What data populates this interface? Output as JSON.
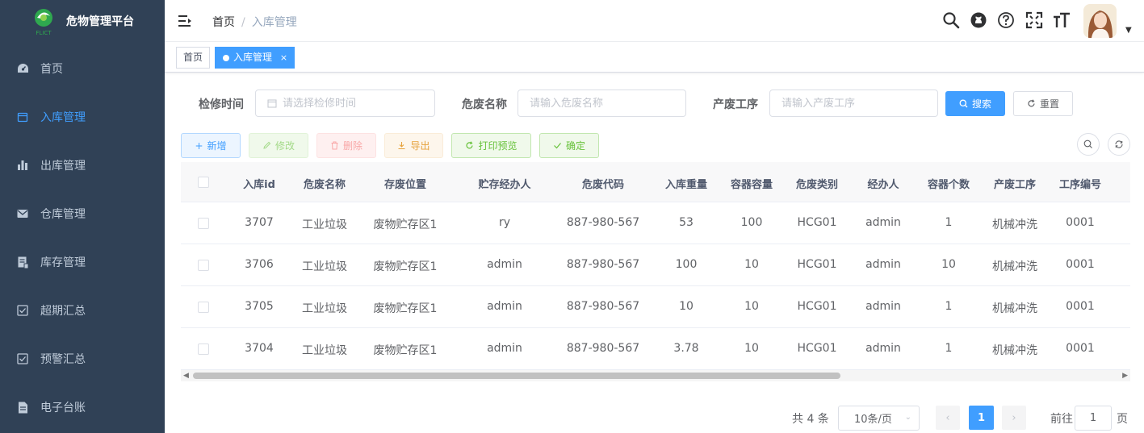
{
  "app": {
    "title": "危物管理平台",
    "logo_sub": "FLICT"
  },
  "sidebar": {
    "items": [
      {
        "label": "首页",
        "icon": "dashboard-icon",
        "active": false
      },
      {
        "label": "入库管理",
        "icon": "calendar-icon",
        "active": true
      },
      {
        "label": "出库管理",
        "icon": "bar-chart-icon",
        "active": false
      },
      {
        "label": "仓库管理",
        "icon": "mail-icon",
        "active": false
      },
      {
        "label": "库存管理",
        "icon": "document-icon",
        "active": false
      },
      {
        "label": "超期汇总",
        "icon": "checkbox-icon",
        "active": false
      },
      {
        "label": "预警汇总",
        "icon": "checkbox-icon",
        "active": false
      },
      {
        "label": "电子台账",
        "icon": "file-icon",
        "active": false
      }
    ]
  },
  "navbar": {
    "breadcrumb": {
      "home": "首页",
      "separator": "/",
      "current": "入库管理"
    }
  },
  "tags": {
    "home": "首页",
    "active": "入库管理",
    "close": "×"
  },
  "search": {
    "fields": [
      {
        "label": "检修时间",
        "placeholder": "请选择检修时间"
      },
      {
        "label": "危废名称",
        "placeholder": "请输入危废名称"
      },
      {
        "label": "产废工序",
        "placeholder": "请输入产废工序"
      }
    ],
    "search_label": "搜索",
    "reset_label": "重置"
  },
  "toolbar": {
    "add": "新增",
    "edit": "修改",
    "delete": "删除",
    "export": "导出",
    "print": "打印预览",
    "confirm": "确定"
  },
  "table": {
    "headers": [
      "入库id",
      "危废名称",
      "存废位置",
      "贮存经办人",
      "危废代码",
      "入库重量",
      "容器容量",
      "危废类别",
      "经办人",
      "容器个数",
      "产废工序",
      "工序编号"
    ],
    "rows": [
      [
        "3707",
        "工业垃圾",
        "废物贮存区1",
        "ry",
        "887-980-567",
        "53",
        "100",
        "HCG01",
        "admin",
        "1",
        "机械冲洗",
        "0001"
      ],
      [
        "3706",
        "工业垃圾",
        "废物贮存区1",
        "admin",
        "887-980-567",
        "100",
        "10",
        "HCG01",
        "admin",
        "10",
        "机械冲洗",
        "0001"
      ],
      [
        "3705",
        "工业垃圾",
        "废物贮存区1",
        "admin",
        "887-980-567",
        "10",
        "10",
        "HCG01",
        "admin",
        "1",
        "机械冲洗",
        "0001"
      ],
      [
        "3704",
        "工业垃圾",
        "废物贮存区1",
        "admin",
        "887-980-567",
        "3.78",
        "10",
        "HCG01",
        "admin",
        "1",
        "机械冲洗",
        "0001"
      ]
    ]
  },
  "pagination": {
    "total": "共 4 条",
    "page_size": "10条/页",
    "prev": "‹",
    "current": "1",
    "next": "›",
    "goto_prefix": "前往",
    "goto_value": "1",
    "goto_suffix": "页"
  },
  "colors": {
    "primary": "#409eff",
    "sidebar_bg": "#304156",
    "success": "#67c23a",
    "danger": "#f56c6c",
    "warning": "#e6a23c"
  }
}
